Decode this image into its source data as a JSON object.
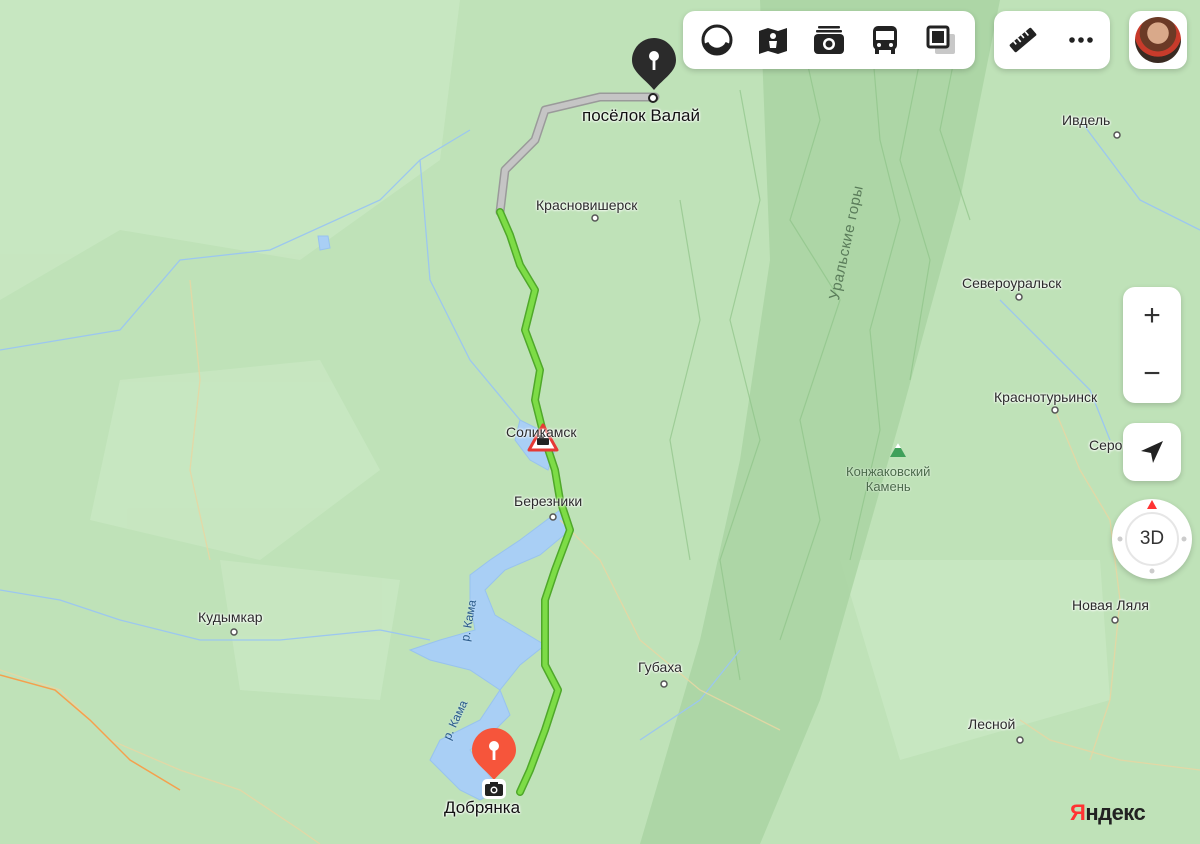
{
  "map": {
    "route_from": "Добрянка",
    "route_to": "посёлок Валай",
    "colors": {
      "land": "#b9dfb2",
      "water": "#a9cff5",
      "route_ok": "#72d640",
      "route_unknown": "#b5b5b5",
      "pin_start": "#f6553b",
      "pin_end": "#2b2b2b"
    }
  },
  "places": {
    "valai": "посёлок Валай",
    "krasnovishersk": "Красновишерск",
    "solikamsk": "Соликамск",
    "berezniki": "Березники",
    "kudymkar": "Кудымкар",
    "gubakha": "Губаха",
    "dobryanka": "Добрянка",
    "ivdel": "Ивдель",
    "severouralsk": "Североуральск",
    "krasnoturinsk": "Краснотурьинск",
    "serov": "Серо",
    "novaya_lyalya": "Новая Ляля",
    "lesnoy": "Лесной",
    "konzhakovsky": "Конжаковский",
    "kamen": "Камень"
  },
  "features": {
    "mountains": "Уральские горы",
    "river1": "р. Кама",
    "river2": "р. Кама"
  },
  "toolbar": {
    "icons": [
      "layers-icon",
      "panorama-icon",
      "photos-icon",
      "transport-icon",
      "schemes-icon"
    ],
    "ruler": "ruler-icon",
    "more": "more-icon"
  },
  "controls": {
    "zoom_in": "+",
    "zoom_out": "−",
    "view_3d": "3D"
  },
  "brand": {
    "logo_y": "Я",
    "logo_rest": "ндекс"
  }
}
